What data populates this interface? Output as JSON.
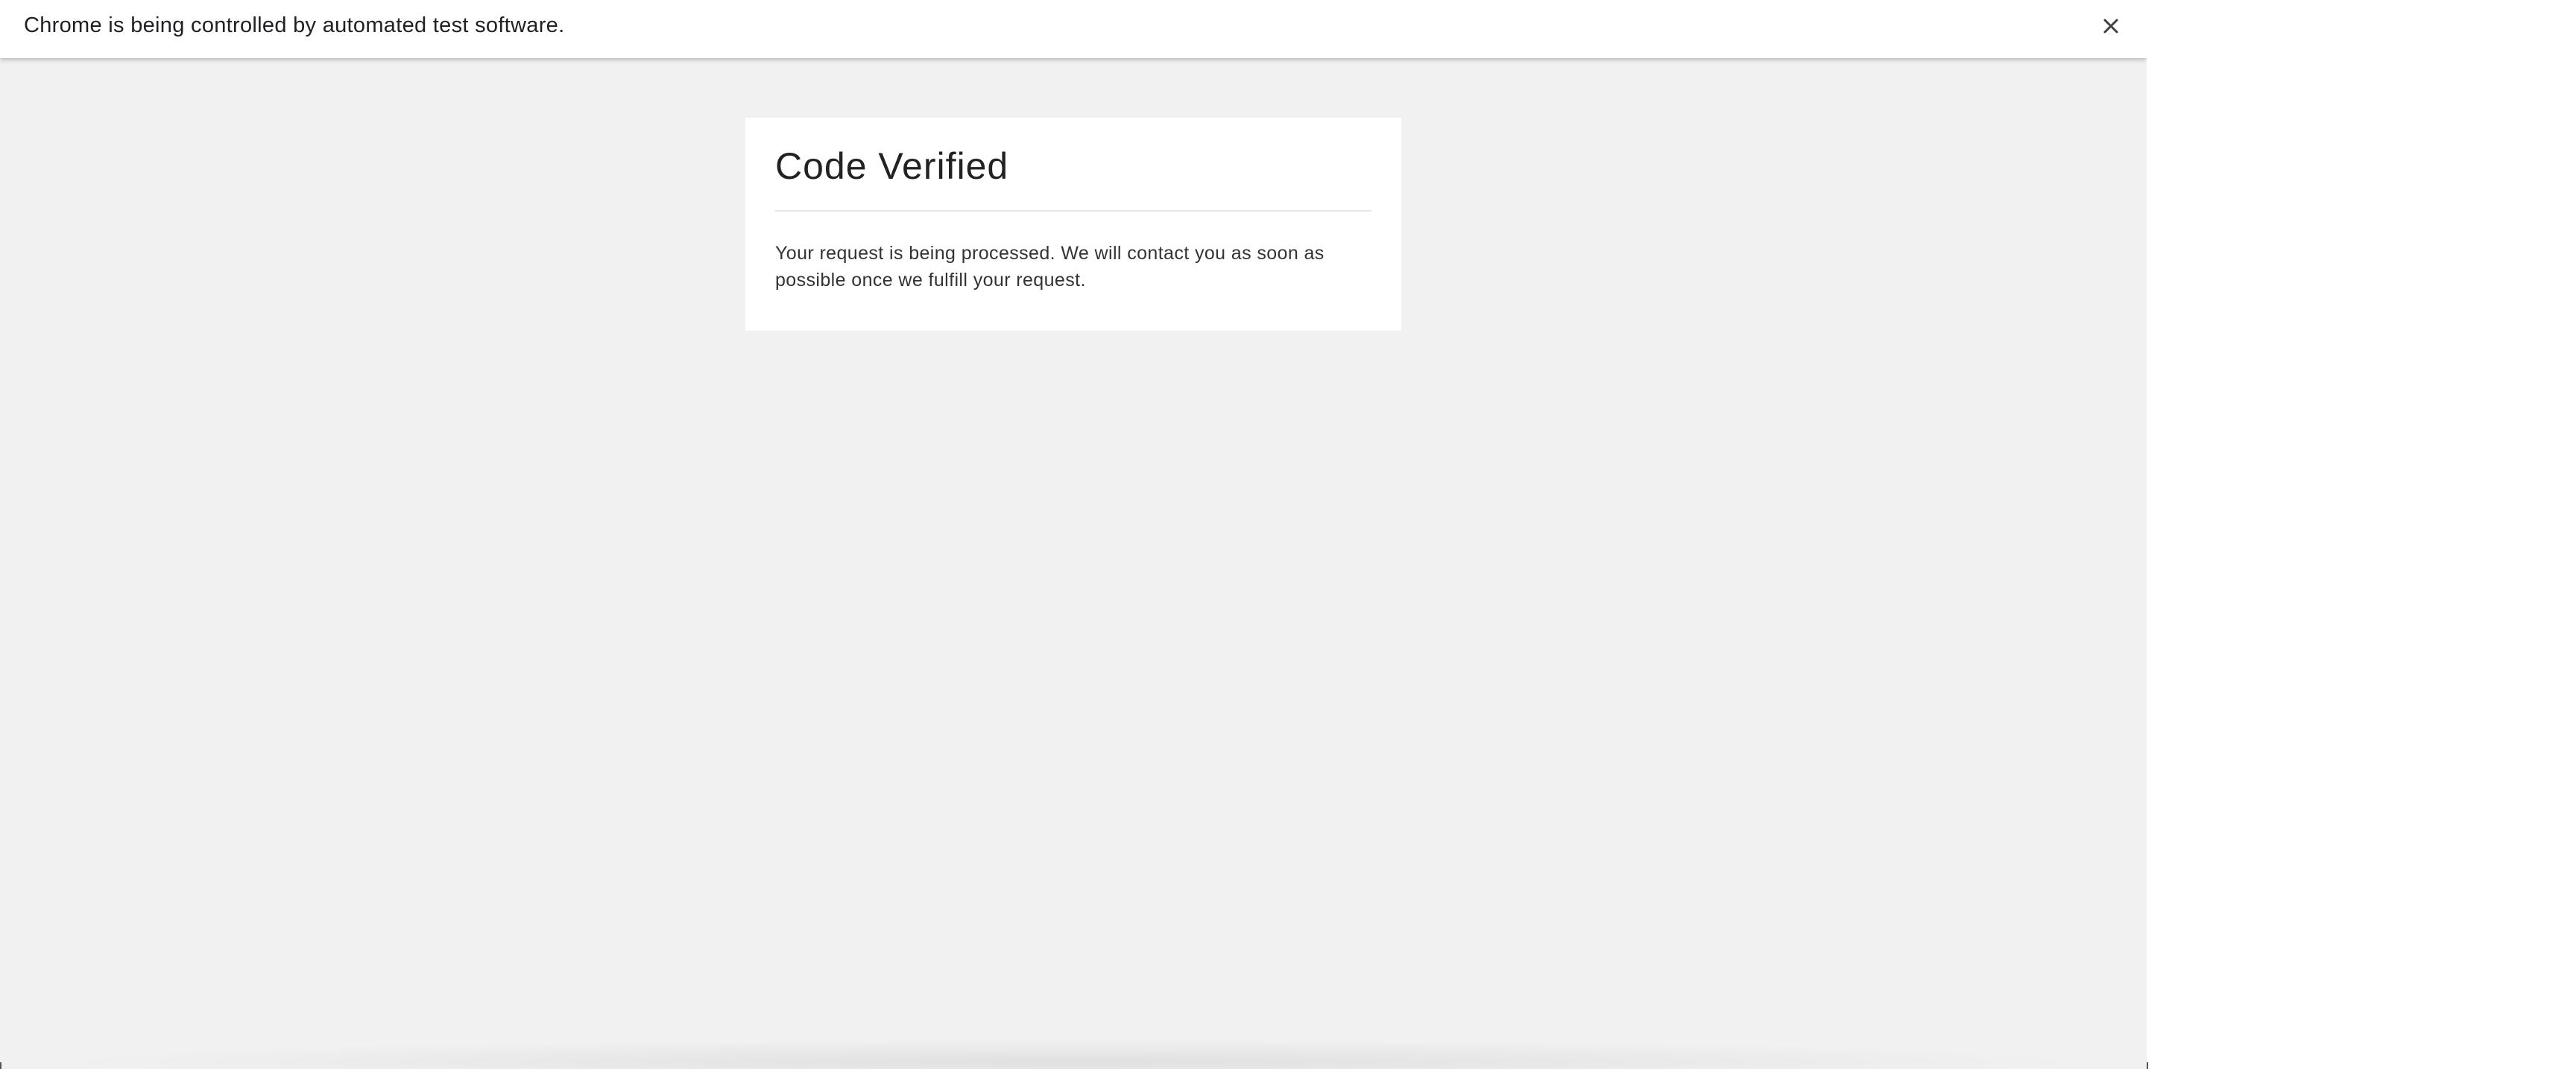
{
  "infobar": {
    "message": "Chrome is being controlled by automated test software.",
    "close_icon": "close-icon"
  },
  "card": {
    "title": "Code Verified",
    "body": "Your request is being processed. We will contact you as soon as possible once we fulfill your request."
  },
  "colors": {
    "page_background": "#f1f1f1",
    "card_background": "#ffffff",
    "infobar_background": "#ffffff",
    "title_text": "#222222"
  }
}
